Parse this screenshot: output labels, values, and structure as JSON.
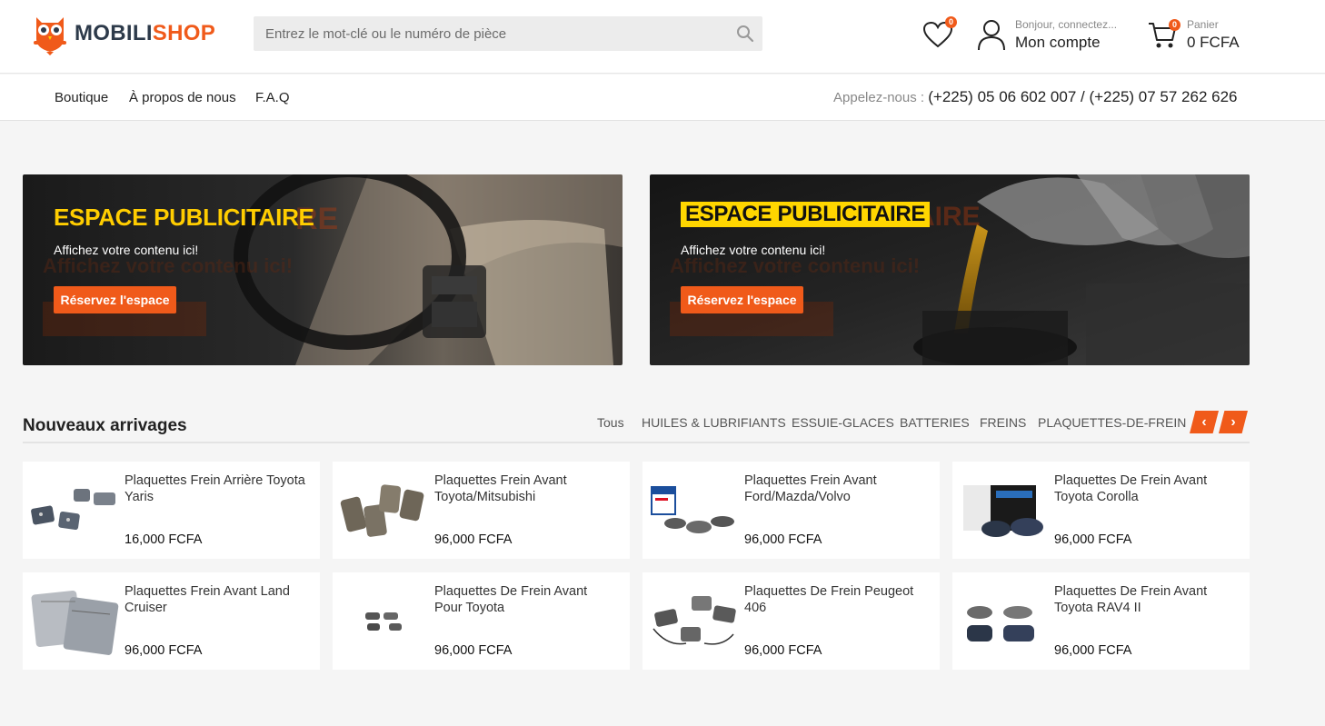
{
  "brand": {
    "part1": "MOBILI",
    "part2": "SHOP",
    "accent": "#f05a1a",
    "dark": "#2d3a4a"
  },
  "search": {
    "placeholder": "Entrez le mot-clé ou le numéro de pièce",
    "icon": "search-icon"
  },
  "wishlist": {
    "count": "0",
    "icon": "heart-icon"
  },
  "account": {
    "greeting": "Bonjour, connectez...",
    "label": "Mon compte",
    "icon": "user-icon"
  },
  "cart": {
    "count": "0",
    "label": "Panier",
    "total": "0 FCFA",
    "icon": "cart-icon"
  },
  "nav": {
    "items": [
      "Boutique",
      "À propos de nous",
      "F.A.Q"
    ],
    "phone_label": "Appelez-nous : ",
    "phone_numbers": "(+225) 05 06 602 007 / (+225) 07 57 262 626"
  },
  "banners": [
    {
      "title": "ESPACE PUBLICITAIRE",
      "ghost": "RE",
      "subtitle": "Affichez votre contenu ici!",
      "ghost_sub": "Affichez votre contenu ici!",
      "button": "Réservez l'espace"
    },
    {
      "title": "ESPACE PUBLICITAIRE",
      "ghost": "AIRE",
      "subtitle": "Affichez votre contenu ici!",
      "ghost_sub": "Affichez votre contenu ici!",
      "button": "Réservez l'espace"
    }
  ],
  "arrivals": {
    "title": "Nouveaux arrivages",
    "tabs": [
      "Tous",
      "HUILES & LUBRIFIANTS",
      "ESSUIE-GLACES",
      "BATTERIES",
      "FREINS",
      "PLAQUETTES-DE-FREIN"
    ],
    "prev": "‹",
    "next": "›",
    "products": [
      {
        "name": "Plaquettes Frein Arrière Toyota Yaris",
        "price": "16,000 FCFA"
      },
      {
        "name": "Plaquettes Frein Avant Toyota/Mitsubishi",
        "price": "96,000 FCFA"
      },
      {
        "name": "Plaquettes Frein Avant Ford/Mazda/Volvo",
        "price": "96,000 FCFA"
      },
      {
        "name": "Plaquettes De Frein Avant Toyota Corolla",
        "price": "96,000 FCFA"
      },
      {
        "name": "Plaquettes Frein Avant Land Cruiser",
        "price": "96,000 FCFA"
      },
      {
        "name": "Plaquettes De Frein Avant Pour Toyota",
        "price": "96,000 FCFA"
      },
      {
        "name": "Plaquettes De Frein Peugeot 406",
        "price": "96,000 FCFA"
      },
      {
        "name": "Plaquettes De Frein Avant Toyota RAV4 II",
        "price": "96,000 FCFA"
      }
    ]
  }
}
